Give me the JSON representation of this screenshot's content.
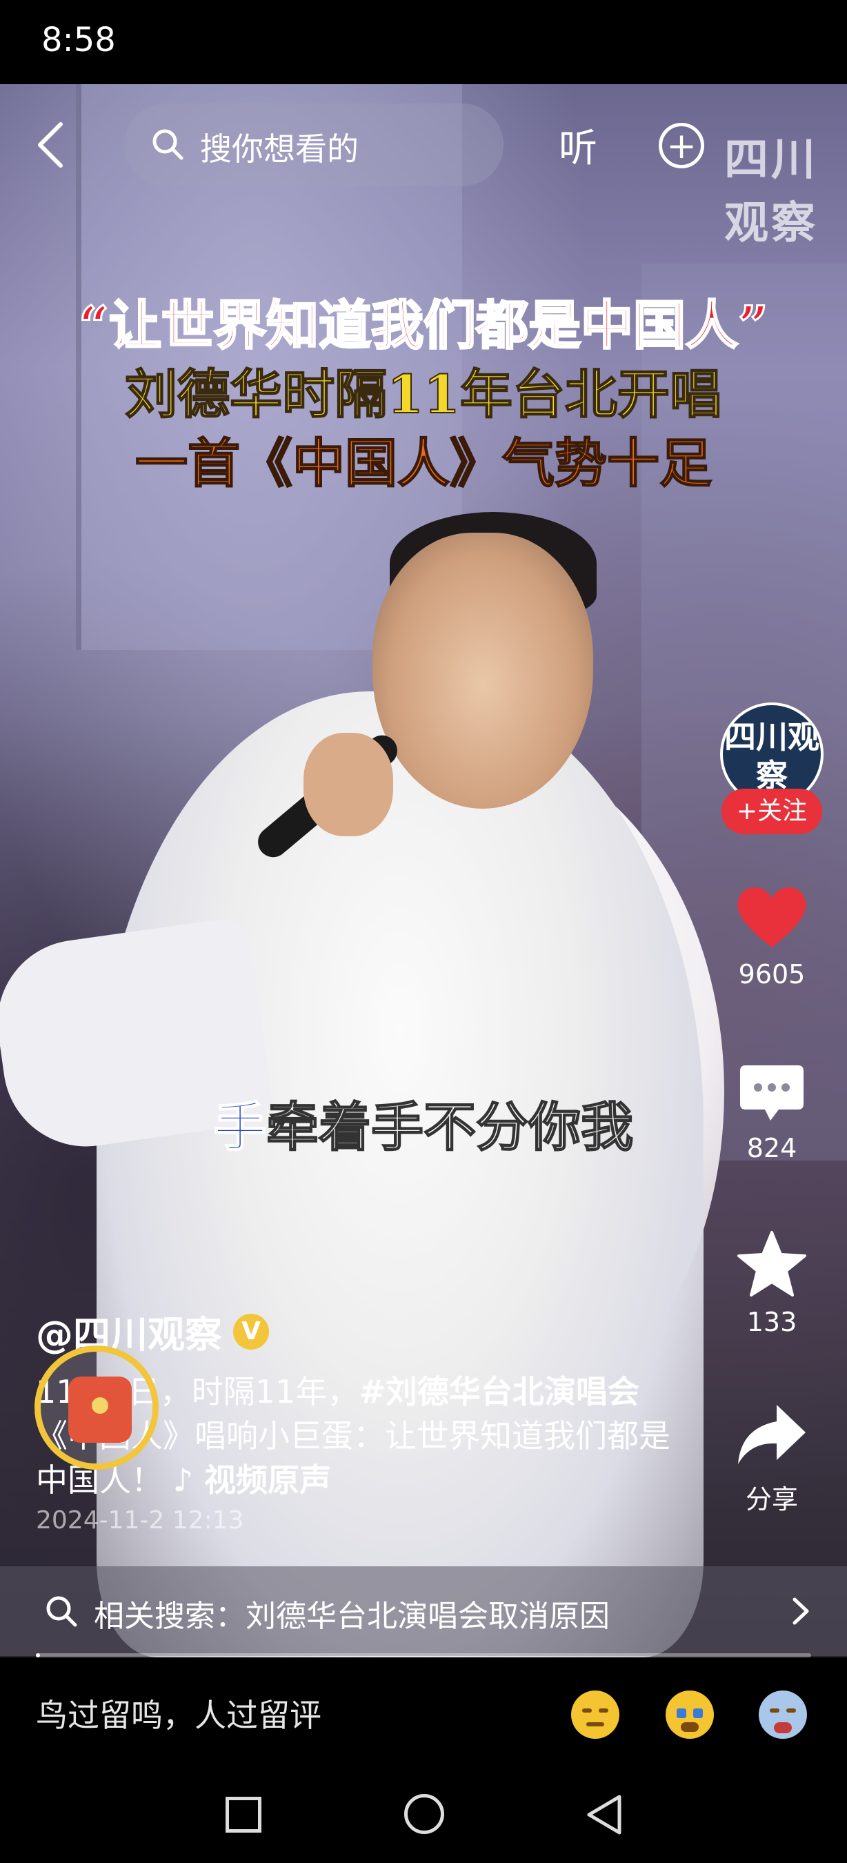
{
  "status_bar": {
    "time": "8:58"
  },
  "top_bar": {
    "search_placeholder": "搜你想看的",
    "listen_label": "听",
    "watermark": "四川观察"
  },
  "video": {
    "headline": {
      "line1": "“让世界知道我们都是中国人”",
      "line2": "刘德华时隔11年台北开唱",
      "line3": "一首《中国人》气势十足"
    },
    "lyric_highlight": "手",
    "lyric_rest": "牵着手不分你我"
  },
  "rail": {
    "avatar_text": "四川观察",
    "follow_label": "+关注",
    "like_count": "9605",
    "comment_count": "824",
    "favorite_count": "133",
    "share_label": "分享"
  },
  "caption": {
    "author": "@四川观察",
    "verified_badge": "V",
    "desc_prefix": "11月1日，时隔11年，",
    "hashtag": "#刘德华台北演唱会",
    "desc_middle": "《中国人》唱响小巨蛋：让世界知道我们都是中国人！",
    "music_label": "♪ 视频原声",
    "date": "2024-11-2 12:13"
  },
  "related_search": {
    "text": "相关搜索：刘德华台北演唱会取消原因"
  },
  "progress": {
    "value": 0.005
  },
  "comment_bar": {
    "placeholder": "鸟过留鸣，人过留评"
  },
  "colors": {
    "like": "#e8313a",
    "follow": "#e8313a",
    "verified": "#f2c53a",
    "headline_red": "#e8202c",
    "headline_yellow": "#f3d82a"
  }
}
